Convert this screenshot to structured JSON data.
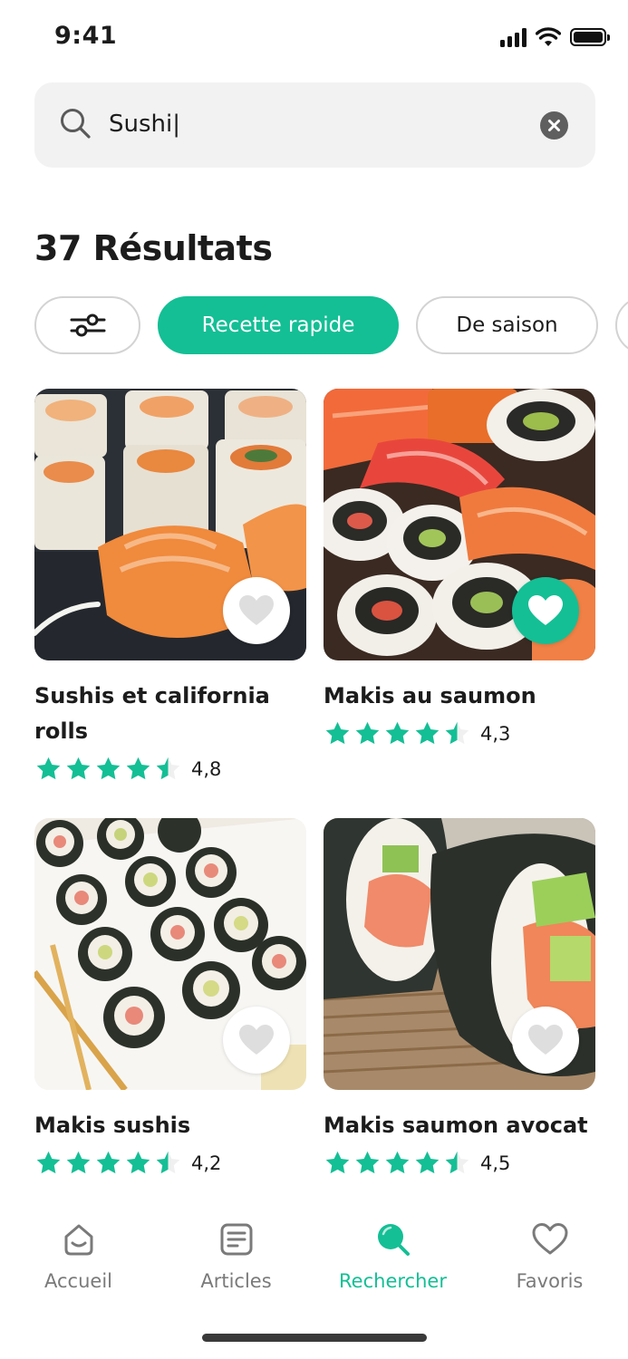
{
  "status_bar": {
    "time": "9:41"
  },
  "search": {
    "value": "Sushi|",
    "placeholder": ""
  },
  "results": {
    "title": "37 Résultats"
  },
  "filters": {
    "chips": [
      {
        "label": "Recette rapide",
        "active": true
      },
      {
        "label": "De saison",
        "active": false
      }
    ]
  },
  "recipes": [
    {
      "title": "Sushis et california rolls",
      "rating": "4,8",
      "favorite": false,
      "stars": 4.5
    },
    {
      "title": "Makis au saumon",
      "rating": "4,3",
      "favorite": true,
      "stars": 4.5
    },
    {
      "title": "Makis sushis",
      "rating": "4,2",
      "favorite": false,
      "stars": 4.5
    },
    {
      "title": "Makis saumon avocat",
      "rating": "4,5",
      "favorite": false,
      "stars": 4.5
    }
  ],
  "tab_bar": {
    "tabs": [
      {
        "label": "Accueil",
        "icon": "home-icon",
        "active": false
      },
      {
        "label": "Articles",
        "icon": "articles-icon",
        "active": false
      },
      {
        "label": "Rechercher",
        "icon": "search-icon",
        "active": true
      },
      {
        "label": "Favoris",
        "icon": "heart-icon",
        "active": false
      }
    ]
  },
  "colors": {
    "accent": "#14bf95",
    "star": "#14bf95",
    "text": "#1c1c1c",
    "muted": "#7a7a7a"
  }
}
